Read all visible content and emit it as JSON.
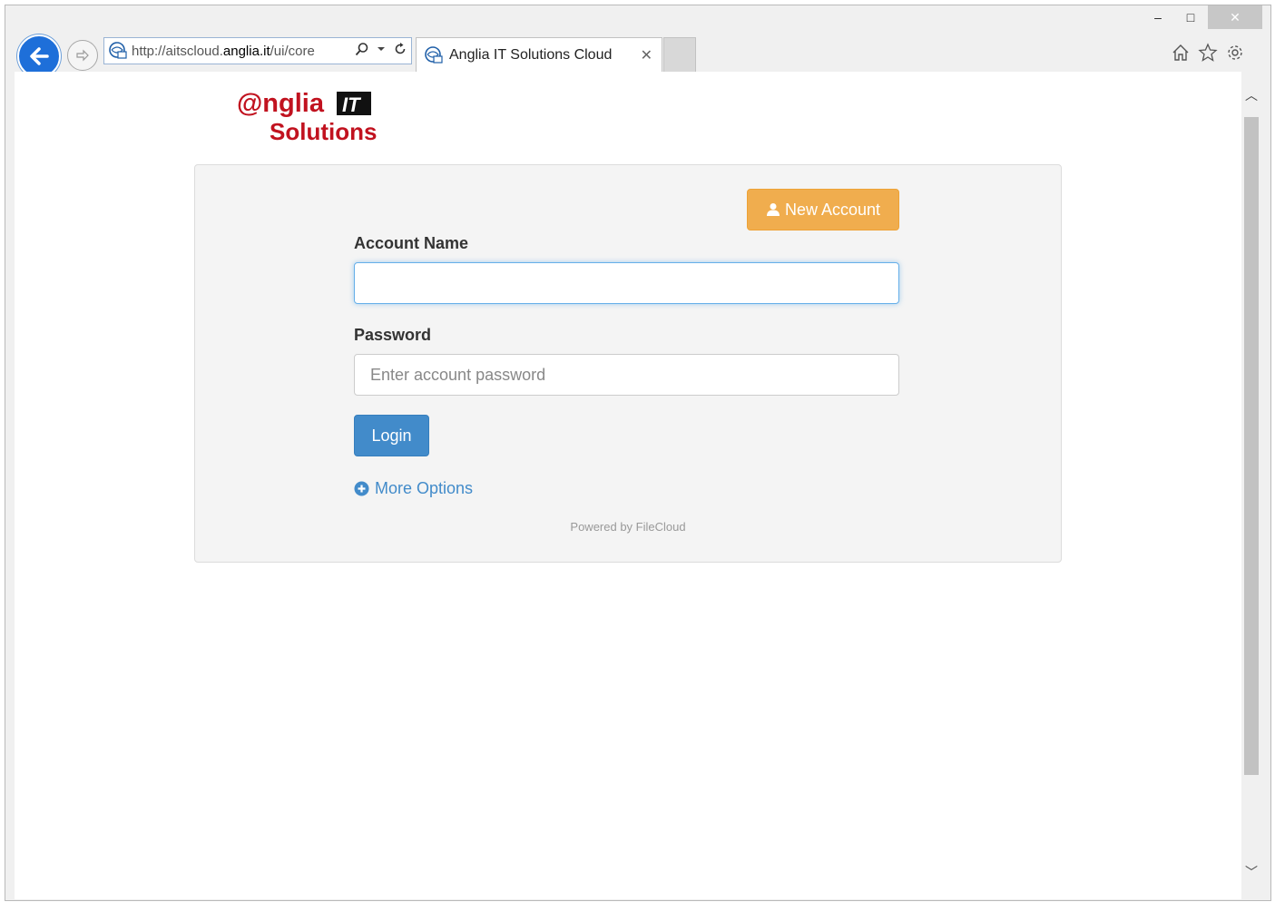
{
  "window": {
    "min_label": "–",
    "max_label": "□",
    "close_label": "✕"
  },
  "browser": {
    "url_prefix": "http://aitscloud.",
    "url_domain": "anglia.it",
    "url_suffix": "/ui/core",
    "tab_title": "Anglia IT Solutions Cloud",
    "icons": [
      "back-arrow-icon",
      "forward-arrow-icon",
      "site-icon",
      "search-icon",
      "dropdown-icon",
      "refresh-icon",
      "close-tab-icon",
      "home-icon",
      "favorites-star-icon",
      "settings-gear-icon"
    ]
  },
  "logo": {
    "line1": "@nglia",
    "badge": "IT",
    "line2": "Solutions",
    "color": "#c1121f"
  },
  "form": {
    "new_account_label": "New Account",
    "account_name_label": "Account Name",
    "account_name_value": "",
    "password_label": "Password",
    "password_placeholder": "Enter account password",
    "login_label": "Login",
    "more_options_label": "More Options",
    "powered_by": "Powered by FileCloud"
  },
  "colors": {
    "accent_orange": "#f0ad4e",
    "accent_blue": "#428bca",
    "panel_bg": "#f4f4f4"
  }
}
